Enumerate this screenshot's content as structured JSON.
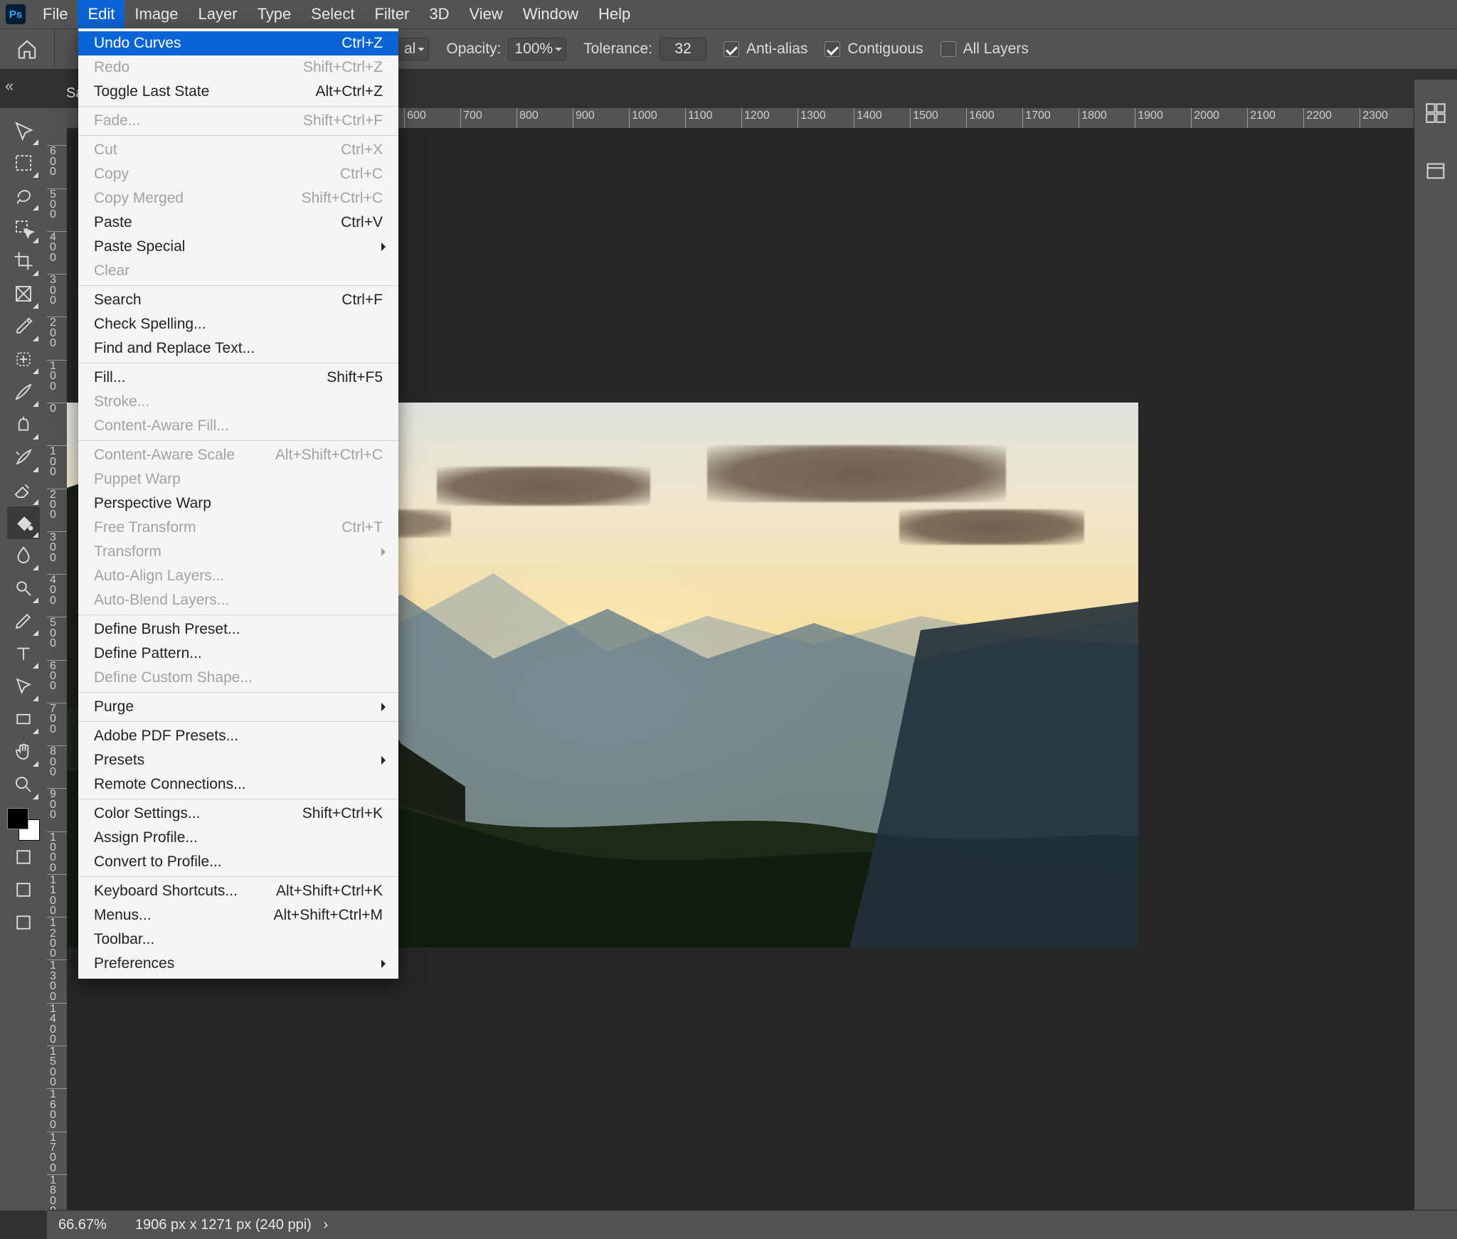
{
  "menubar": {
    "items": [
      "File",
      "Edit",
      "Image",
      "Layer",
      "Type",
      "Select",
      "Filter",
      "3D",
      "View",
      "Window",
      "Help"
    ],
    "open": 1
  },
  "options": {
    "doc_hidden": "al",
    "opacity_label": "Opacity:",
    "opacity_value": "100%",
    "tolerance_label": "Tolerance:",
    "tolerance_value": "32",
    "antialias": "Anti-alias",
    "contiguous": "Contiguous",
    "all_layers": "All Layers"
  },
  "doc_tab": "Sa",
  "zoom": "66.67%",
  "doc_info": "1906 px x 1271 px (240 ppi)",
  "ruler_h_start": 300,
  "ruler_h_step": 100,
  "ruler_h_count": 22,
  "ruler_v_start": 600,
  "ruler_v_step": 100,
  "ruler_v_origin": 386,
  "edit_menu": [
    {
      "t": "row",
      "label": "Undo Curves",
      "sc": "Ctrl+Z",
      "hover": true
    },
    {
      "t": "row",
      "label": "Redo",
      "sc": "Shift+Ctrl+Z",
      "dis": true
    },
    {
      "t": "row",
      "label": "Toggle Last State",
      "sc": "Alt+Ctrl+Z"
    },
    {
      "t": "sep"
    },
    {
      "t": "row",
      "label": "Fade...",
      "sc": "Shift+Ctrl+F",
      "dis": true
    },
    {
      "t": "sep"
    },
    {
      "t": "row",
      "label": "Cut",
      "sc": "Ctrl+X",
      "dis": true
    },
    {
      "t": "row",
      "label": "Copy",
      "sc": "Ctrl+C",
      "dis": true
    },
    {
      "t": "row",
      "label": "Copy Merged",
      "sc": "Shift+Ctrl+C",
      "dis": true
    },
    {
      "t": "row",
      "label": "Paste",
      "sc": "Ctrl+V"
    },
    {
      "t": "row",
      "label": "Paste Special",
      "sub": true
    },
    {
      "t": "row",
      "label": "Clear",
      "dis": true
    },
    {
      "t": "sep"
    },
    {
      "t": "row",
      "label": "Search",
      "sc": "Ctrl+F"
    },
    {
      "t": "row",
      "label": "Check Spelling..."
    },
    {
      "t": "row",
      "label": "Find and Replace Text..."
    },
    {
      "t": "sep"
    },
    {
      "t": "row",
      "label": "Fill...",
      "sc": "Shift+F5"
    },
    {
      "t": "row",
      "label": "Stroke...",
      "dis": true
    },
    {
      "t": "row",
      "label": "Content-Aware Fill...",
      "dis": true
    },
    {
      "t": "sep"
    },
    {
      "t": "row",
      "label": "Content-Aware Scale",
      "sc": "Alt+Shift+Ctrl+C",
      "dis": true
    },
    {
      "t": "row",
      "label": "Puppet Warp",
      "dis": true
    },
    {
      "t": "row",
      "label": "Perspective Warp"
    },
    {
      "t": "row",
      "label": "Free Transform",
      "sc": "Ctrl+T",
      "dis": true
    },
    {
      "t": "row",
      "label": "Transform",
      "sub": true,
      "dis": true
    },
    {
      "t": "row",
      "label": "Auto-Align Layers...",
      "dis": true
    },
    {
      "t": "row",
      "label": "Auto-Blend Layers...",
      "dis": true
    },
    {
      "t": "sep"
    },
    {
      "t": "row",
      "label": "Define Brush Preset..."
    },
    {
      "t": "row",
      "label": "Define Pattern..."
    },
    {
      "t": "row",
      "label": "Define Custom Shape...",
      "dis": true
    },
    {
      "t": "sep"
    },
    {
      "t": "row",
      "label": "Purge",
      "sub": true
    },
    {
      "t": "sep"
    },
    {
      "t": "row",
      "label": "Adobe PDF Presets..."
    },
    {
      "t": "row",
      "label": "Presets",
      "sub": true
    },
    {
      "t": "row",
      "label": "Remote Connections..."
    },
    {
      "t": "sep"
    },
    {
      "t": "row",
      "label": "Color Settings...",
      "sc": "Shift+Ctrl+K"
    },
    {
      "t": "row",
      "label": "Assign Profile..."
    },
    {
      "t": "row",
      "label": "Convert to Profile..."
    },
    {
      "t": "sep"
    },
    {
      "t": "row",
      "label": "Keyboard Shortcuts...",
      "sc": "Alt+Shift+Ctrl+K"
    },
    {
      "t": "row",
      "label": "Menus...",
      "sc": "Alt+Shift+Ctrl+M"
    },
    {
      "t": "row",
      "label": "Toolbar..."
    },
    {
      "t": "row",
      "label": "Preferences",
      "sub": true
    }
  ],
  "tools": [
    "move",
    "marquee",
    "lasso",
    "object-select",
    "crop",
    "frame",
    "eyedropper",
    "healing",
    "brush",
    "clone",
    "history-brush",
    "eraser",
    "bucket",
    "blur",
    "dodge",
    "pen",
    "type",
    "path-select",
    "rectangle",
    "hand",
    "zoom"
  ],
  "tool_selected": 12
}
